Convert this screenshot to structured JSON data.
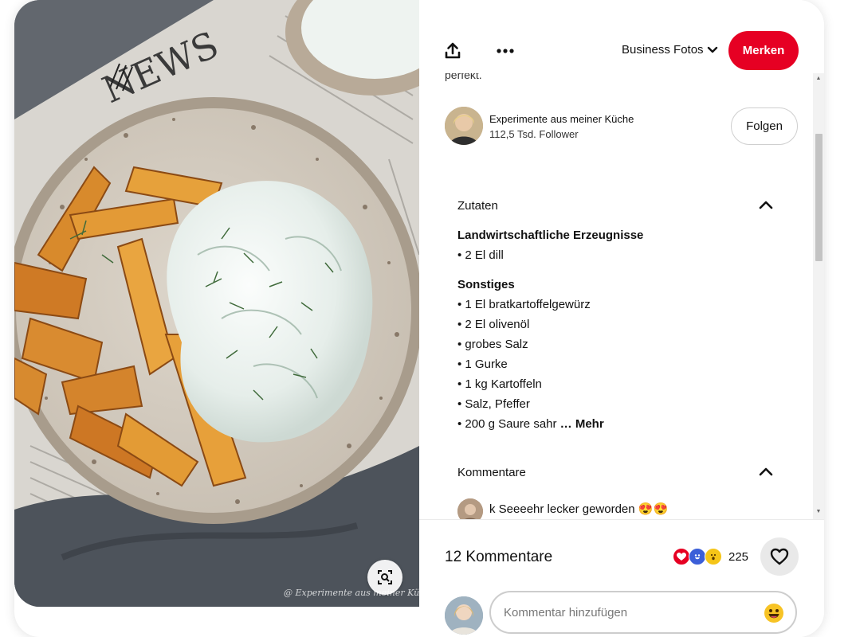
{
  "colors": {
    "brand_red": "#e60023",
    "follow_border": "#cfcfcf"
  },
  "photo": {
    "watermark": "@ Experimente aus meiner Küche",
    "lens_icon": "visual-search-icon"
  },
  "header": {
    "share_icon": "share-icon",
    "more_icon": "more-dots-icon",
    "board_name": "Business Fotos",
    "board_chevron_icon": "chevron-down-icon",
    "save_label": "Merken"
  },
  "description_tail": "perfekt.",
  "creator": {
    "name": "Experimente aus meiner Küche",
    "followers": "112,5 Tsd. Follower",
    "follow_label": "Folgen"
  },
  "ingredients": {
    "title": "Zutaten",
    "groups": [
      {
        "title": "Landwirtschaftliche Erzeugnisse",
        "items": [
          "• 2 El dill"
        ]
      },
      {
        "title": "Sonstiges",
        "items": [
          "• 1 El bratkartoffelgewürz",
          "• 2 El olivenöl",
          "• grobes Salz",
          "• 1 Gurke",
          "• 1 kg Kartoffeln",
          "• Salz, Pfeffer",
          "• 200 g Saure sahr"
        ]
      }
    ],
    "more_label": "… Mehr"
  },
  "comments": {
    "title": "Kommentare",
    "first": {
      "author": "k",
      "text": "Seeeehr lecker geworden 😍😍"
    }
  },
  "footer": {
    "count_label": "12 Kommentare",
    "reaction_count": "225",
    "input_placeholder": "Kommentar hinzufügen"
  }
}
